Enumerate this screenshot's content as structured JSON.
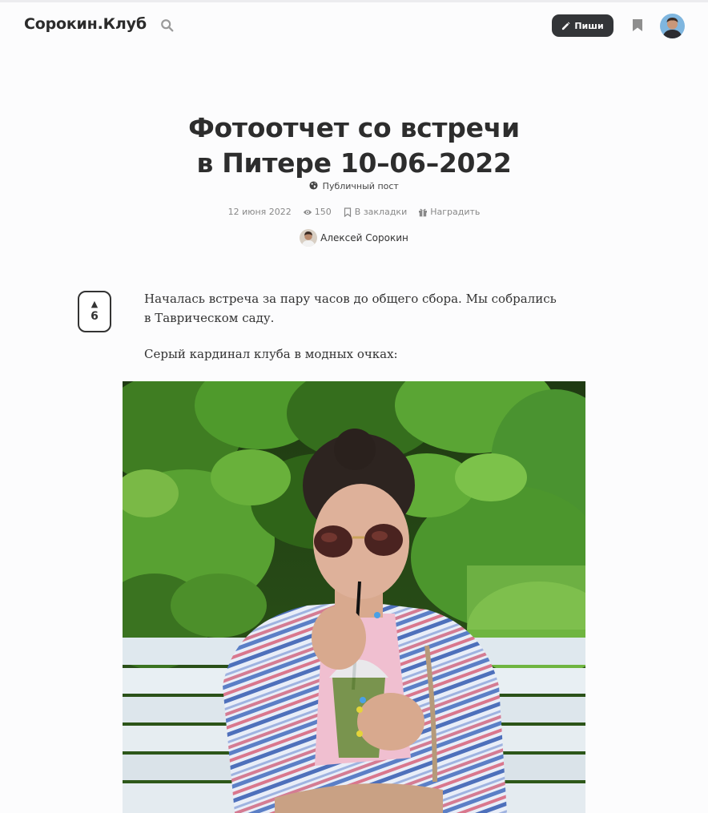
{
  "header": {
    "logo": "Сорокин.Клуб",
    "write_label": "Пиши"
  },
  "post": {
    "title_line1": "Фотоотчет со встречи",
    "title_line2": "в Питере 10–06–2022",
    "visibility": "Публичный пост",
    "date": "12 июня 2022",
    "views": "150",
    "bookmark_label": "В закладки",
    "reward_label": "Наградить",
    "author": "Алексей Сорокин",
    "upvotes": "6",
    "upvote_arrow": "▲",
    "paragraphs": [
      "Началась встреча за пару часов до общего сбора. Мы собрались в Таврическом саду.",
      "Серый кардинал клуба в модных очках:"
    ]
  },
  "colors": {
    "dark": "#333538",
    "muted": "#888888",
    "background": "#fcfcfd"
  }
}
